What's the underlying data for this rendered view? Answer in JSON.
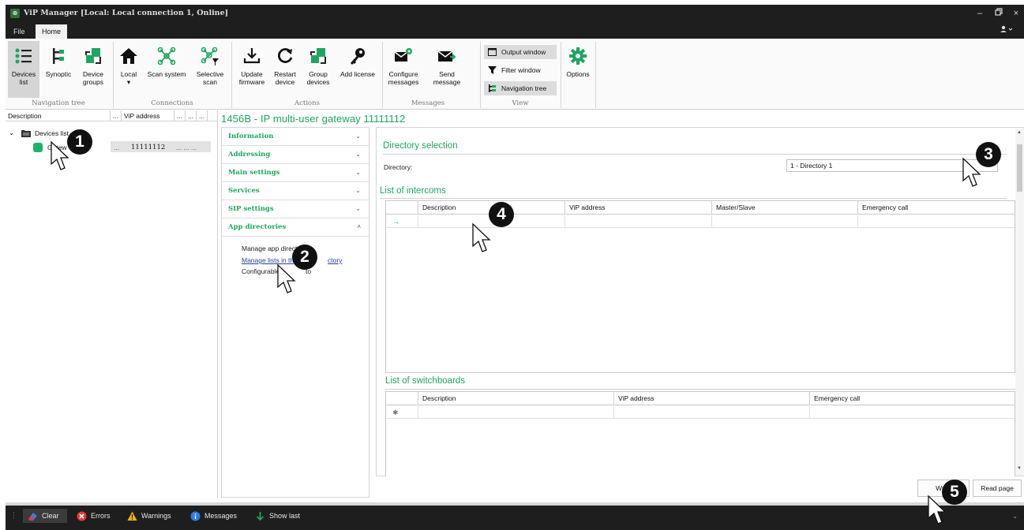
{
  "window": {
    "title": "ViP Manager [Local: Local connection 1, Online]",
    "controls": {
      "minimize": "–",
      "maximize": "▫",
      "close": "×"
    }
  },
  "menu": {
    "tabs": [
      {
        "label": "File",
        "active": false
      },
      {
        "label": "Home",
        "active": true
      }
    ],
    "user_icon": "user-icon"
  },
  "ribbon": {
    "groups": [
      {
        "label": "Navigation tree",
        "buttons": [
          {
            "label": "Devices\nlist",
            "icon": "devices-list-icon",
            "selected": true
          },
          {
            "label": "Synoptic",
            "icon": "synoptic-icon"
          },
          {
            "label": "Device\ngroups",
            "icon": "device-groups-icon"
          }
        ]
      },
      {
        "label": "Connections",
        "buttons": [
          {
            "label": "Local\n▾",
            "icon": "home-icon"
          },
          {
            "label": "Scan system",
            "icon": "scan-system-icon"
          },
          {
            "label": "Selective\nscan",
            "icon": "selective-scan-icon"
          }
        ]
      },
      {
        "label": "Actions",
        "buttons": [
          {
            "label": "Update\nfirmware",
            "icon": "download-icon"
          },
          {
            "label": "Restart\ndevice",
            "icon": "restart-icon"
          },
          {
            "label": "Group\ndevices",
            "icon": "group-devices-icon"
          },
          {
            "label": "Add license",
            "icon": "key-icon"
          }
        ]
      },
      {
        "label": "Messages",
        "buttons": [
          {
            "label": "Configure\nmessages",
            "icon": "configure-messages-icon"
          },
          {
            "label": "Send message",
            "icon": "send-message-icon"
          }
        ]
      },
      {
        "label": "View",
        "buttons": [
          {
            "label": "Output window",
            "icon": "output-window-icon",
            "selected": true
          },
          {
            "label": "Filter window",
            "icon": "filter-icon"
          },
          {
            "label": "Navigation tree",
            "icon": "navigation-tree-icon",
            "selected": true
          }
        ]
      },
      {
        "label": "",
        "buttons": [
          {
            "label": "Options",
            "icon": "gear-icon"
          }
        ]
      }
    ]
  },
  "tree": {
    "columns": [
      "Description",
      "...",
      "ViP address",
      "...",
      "...",
      "..."
    ],
    "root_label": "Devices list",
    "device_label": "Gatew",
    "device_dots": "...",
    "device_address": "11111112",
    "device_trailing": "...     ...   ..."
  },
  "main": {
    "title": "1456B - IP multi-user gateway 11111112"
  },
  "sidebar": {
    "items": [
      {
        "label": "Information",
        "expanded": false
      },
      {
        "label": "Addressing",
        "expanded": false
      },
      {
        "label": "Main settings",
        "expanded": false
      },
      {
        "label": "Services",
        "expanded": false
      },
      {
        "label": "SIP settings",
        "expanded": false
      },
      {
        "label": "App directories",
        "expanded": true
      }
    ],
    "subitems": [
      {
        "label": "Manage app directo",
        "link": false
      },
      {
        "label": "Manage lists in th",
        "tail": "ctory",
        "link": true
      },
      {
        "label": "Configurable",
        "tail": "to",
        "link": false
      }
    ]
  },
  "directory_selection": {
    "title": "Directory selection",
    "label": "Directory:",
    "value": "1 - Directory 1"
  },
  "intercoms": {
    "title": "List of intercoms",
    "columns": [
      "",
      "Description",
      "ViP address",
      "Master/Slave",
      "Emergency call"
    ],
    "new_row_marker": "→"
  },
  "switchboards": {
    "title": "List of switchboards",
    "columns": [
      "",
      "Description",
      "ViP address",
      "Emergency call"
    ],
    "new_row_marker": "✱"
  },
  "buttons": {
    "write": "Write",
    "read_page": "Read page"
  },
  "output_bar": {
    "items": [
      {
        "label": "Clear",
        "icon": "eraser-icon"
      },
      {
        "label": "Errors",
        "icon": "error-icon"
      },
      {
        "label": "Warnings",
        "icon": "warning-icon"
      },
      {
        "label": "Messages",
        "icon": "info-icon"
      },
      {
        "label": "Show last",
        "icon": "arrow-down-icon"
      }
    ]
  },
  "annotations": [
    "1",
    "2",
    "3",
    "4",
    "5"
  ],
  "colors": {
    "accent": "#1ea560",
    "titlebar": "#1e1e1e",
    "device_status": "#1fb26a"
  }
}
